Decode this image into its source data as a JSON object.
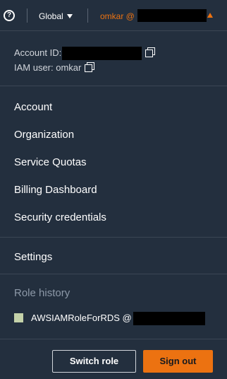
{
  "topbar": {
    "help_symbol": "?",
    "region_label": "Global",
    "user_label": "omkar @"
  },
  "account": {
    "account_id_label": "Account ID:",
    "iam_user_label": "IAM user: omkar"
  },
  "menu": {
    "items": [
      {
        "label": "Account"
      },
      {
        "label": "Organization"
      },
      {
        "label": "Service Quotas"
      },
      {
        "label": "Billing Dashboard"
      },
      {
        "label": "Security credentials"
      }
    ],
    "settings_label": "Settings"
  },
  "role_history": {
    "title": "Role history",
    "role_label": "AWSIAMRoleForRDS @",
    "swatch_color": "#c4d2a9"
  },
  "footer": {
    "switch_role_label": "Switch role",
    "sign_out_label": "Sign out"
  },
  "colors": {
    "background": "#232f3e",
    "accent": "#ec7211",
    "muted_text": "#8d99a8"
  },
  "icons": [
    "help-icon",
    "caret-down-icon",
    "caret-up-icon",
    "copy-icon"
  ]
}
